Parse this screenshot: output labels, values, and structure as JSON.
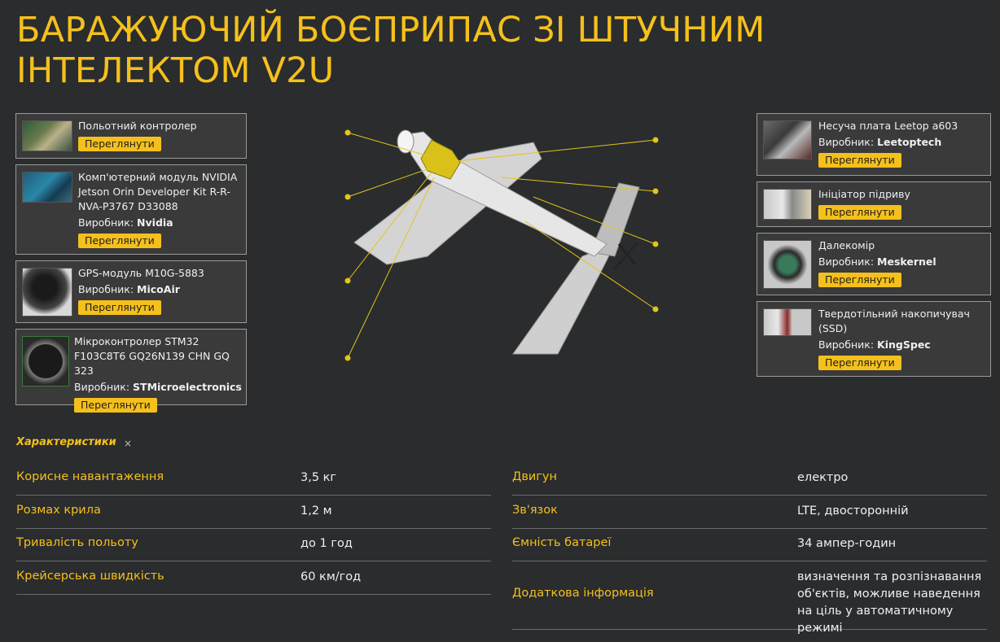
{
  "title": "БАРАЖУЮЧИЙ БОЄПРИПАС ЗІ ШТУЧНИМ ІНТЕЛЕКТОМ V2U",
  "accent_color": "#f5c01c",
  "components_left": [
    {
      "name": "Польотний контролер",
      "maker_label": "",
      "maker": "",
      "button": "Переглянути"
    },
    {
      "name": "Комп'ютерний модуль NVIDIA Jetson Orin Developer Kit R-R-NVA-P3767 D33088",
      "maker_label": "Виробник:",
      "maker": "Nvidia",
      "button": "Переглянути"
    },
    {
      "name": "GPS-модуль M10G-5883",
      "maker_label": "Виробник:",
      "maker": "MicoAir",
      "button": "Переглянути"
    },
    {
      "name": "Мікроконтролер STM32 F103C8T6 GQ26N139 CHN GQ 323",
      "maker_label": "Виробник:",
      "maker": "STMicroelectronics",
      "button": "Переглянути"
    }
  ],
  "components_right": [
    {
      "name": "Несуча плата Leetop a603",
      "maker_label": "Виробник:",
      "maker": "Leetoptech",
      "button": "Переглянути"
    },
    {
      "name": "Ініціатор підриву",
      "maker_label": "",
      "maker": "",
      "button": "Переглянути"
    },
    {
      "name": "Далекомір",
      "maker_label": "Виробник:",
      "maker": "Meskernel",
      "button": "Переглянути"
    },
    {
      "name": "Твердотільний накопичувач (SSD)",
      "maker_label": "Виробник:",
      "maker": "KingSpec",
      "button": "Переглянути"
    }
  ],
  "specs": {
    "heading": "Характеристики",
    "close": "×",
    "left": [
      {
        "key": "Корисне навантаження",
        "value": "3,5 кг"
      },
      {
        "key": "Розмах крила",
        "value": "1,2 м"
      },
      {
        "key": "Тривалість польоту",
        "value": "до 1 год"
      },
      {
        "key": "Крейсерська швидкість",
        "value": "60 км/год"
      }
    ],
    "right": [
      {
        "key": "Двигун",
        "value": "електро"
      },
      {
        "key": "Зв'язок",
        "value": "LTE, двосторонній"
      },
      {
        "key": "Ємність батареї",
        "value": "34 ампер-годин"
      },
      {
        "key": "Додаткова інформація",
        "value": "визначення та розпізнавання об'єктів, можливе наведення на ціль у автоматичному режимі"
      }
    ]
  }
}
